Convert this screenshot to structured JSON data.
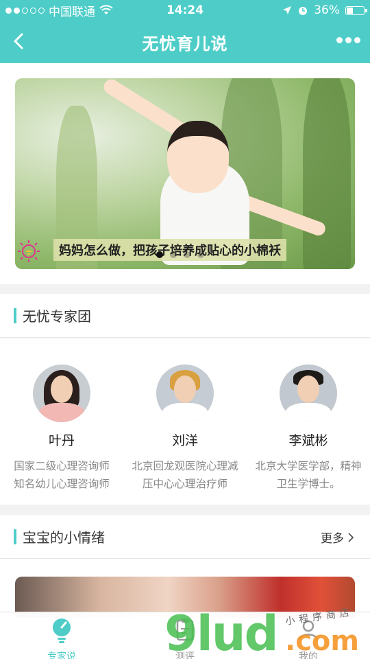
{
  "status_bar": {
    "carrier": "中国联通",
    "time": "14:24",
    "battery": "36%",
    "battery_level": 0.36,
    "signal_strength": 2
  },
  "nav": {
    "title": "无忧育儿说",
    "back_icon": "chevron-left-icon",
    "more_icon": "more-dots-icon"
  },
  "banner": {
    "caption": "妈妈怎么做，把孩子培养成贴心的小棉袄",
    "slide_count": 4,
    "active_slide": 1
  },
  "experts_section": {
    "title": "无忧专家团",
    "experts": [
      {
        "name": "叶丹",
        "desc_line1": "国家二级心理咨询师",
        "desc_line2": "知名幼儿心理咨询师"
      },
      {
        "name": "刘洋",
        "desc_line1": "北京回龙观医院心理减",
        "desc_line2": "压中心心理治疗师"
      },
      {
        "name": "李斌彬",
        "desc_line1": "北京大学医学部，精神",
        "desc_line2": "卫生学博士。"
      }
    ]
  },
  "emotions_section": {
    "title": "宝宝的小情绪",
    "more_label": "更多"
  },
  "tabbar": {
    "tabs": [
      {
        "label": "专家说",
        "icon": "lightbulb-icon",
        "active": true
      },
      {
        "label": "测评",
        "icon": "clipboard-icon",
        "active": false
      },
      {
        "label": "我的",
        "icon": "user-icon",
        "active": false
      }
    ]
  },
  "watermark": {
    "big": "9lud",
    "com": ".com",
    "small": "小程序商店"
  },
  "colors": {
    "accent": "#4ecdc8",
    "background": "#f2f2f2"
  }
}
